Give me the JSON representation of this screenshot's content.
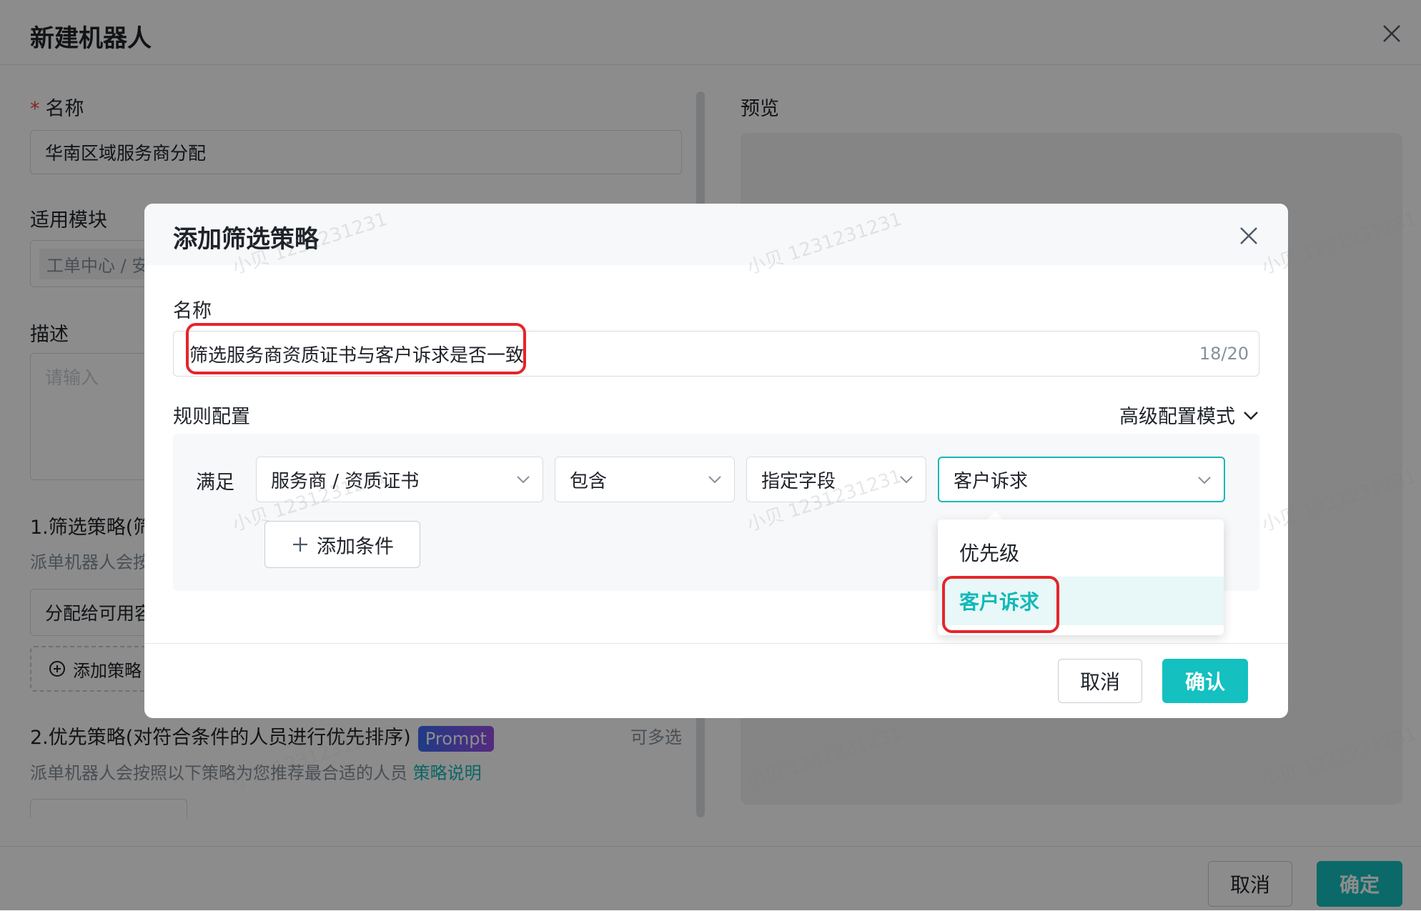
{
  "drawer": {
    "title": "新建机器人",
    "name_label": "名称",
    "name_value": "华南区域服务商分配",
    "module_label": "适用模块",
    "module_tag": "工单中心 / 安",
    "desc_label": "描述",
    "desc_placeholder": "请输入",
    "section1_title": "1.筛选策略(筛",
    "section1_desc": "派单机器人会按",
    "strategy_item": "分配给可用容",
    "add_strategy": "添加策略",
    "section2_title": "2.优先策略(对符合条件的人员进行优先排序)",
    "prompt_badge": "Prompt",
    "multi_select": "可多选",
    "section2_desc": "派单机器人会按照以下策略为您推荐最合适的人员",
    "strategy_link": "策略说明",
    "preview_label": "预览",
    "cancel": "取消",
    "confirm": "确定"
  },
  "modal": {
    "title": "添加筛选策略",
    "name_label": "名称",
    "name_value": "筛选服务商资质证书与客户诉求是否一致",
    "name_counter": "18/20",
    "rule_label": "规则配置",
    "advanced_mode": "高级配置模式",
    "satisfy": "满足",
    "field_select": "服务商 / 资质证书",
    "operator_select": "包含",
    "value_type_select": "指定字段",
    "value_select": "客户诉求",
    "add_condition": "添加条件",
    "cancel": "取消",
    "confirm": "确认"
  },
  "dropdown": {
    "options": [
      "优先级",
      "客户诉求"
    ],
    "selected": "客户诉求"
  },
  "watermark": "小贝 1231231231",
  "colors": {
    "accent": "#14c0c0",
    "annotation": "#e5252a",
    "required": "#f53f3f"
  },
  "icons": [
    "close-icon",
    "chevron-down-icon",
    "plus-icon",
    "plus-circle-icon"
  ]
}
